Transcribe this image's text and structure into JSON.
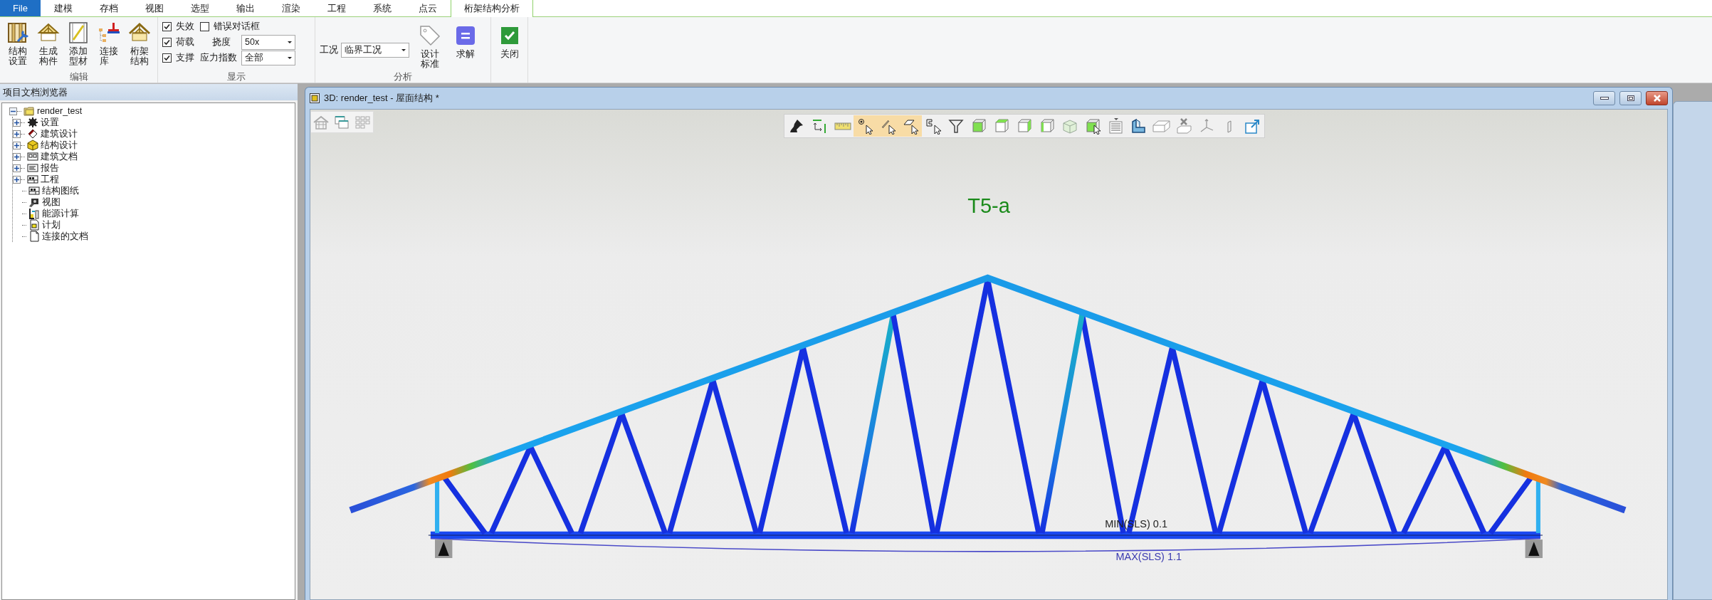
{
  "ribbon": {
    "tabs": [
      {
        "label": "File",
        "kind": "file",
        "selected": false
      },
      {
        "label": "建模",
        "kind": "tab",
        "selected": false
      },
      {
        "label": "存档",
        "kind": "tab",
        "selected": false
      },
      {
        "label": "视图",
        "kind": "tab",
        "selected": false
      },
      {
        "label": "选型",
        "kind": "tab",
        "selected": false
      },
      {
        "label": "输出",
        "kind": "tab",
        "selected": false
      },
      {
        "label": "渲染",
        "kind": "tab",
        "selected": false
      },
      {
        "label": "工程",
        "kind": "tab",
        "selected": false
      },
      {
        "label": "系统",
        "kind": "tab",
        "selected": false
      },
      {
        "label": "点云",
        "kind": "tab",
        "selected": false
      },
      {
        "label": "桁架结构分析",
        "kind": "tab",
        "selected": true
      }
    ],
    "edit_group": {
      "label": "编辑",
      "buttons": [
        {
          "label": "结构设置"
        },
        {
          "label": "生成构件"
        },
        {
          "label": "添加型材"
        },
        {
          "label": "连接库"
        },
        {
          "label": "桁架结构"
        }
      ]
    },
    "display_group": {
      "label": "显示",
      "checkboxes": [
        {
          "label": "失效",
          "checked": true
        },
        {
          "label": "荷载",
          "checked": true
        },
        {
          "label": "支撑",
          "checked": true
        },
        {
          "label": "错误对话框",
          "checked": false
        }
      ],
      "deflection": {
        "label": "挠度",
        "value": "50x"
      },
      "stress_index": {
        "label": "应力指数",
        "value": "全部"
      }
    },
    "analysis_group": {
      "label": "分析",
      "load_case": {
        "label": "工况",
        "value": "临界工况"
      },
      "buttons": [
        {
          "label": "设计标准"
        },
        {
          "label": "求解"
        }
      ]
    },
    "close_group": {
      "buttons": [
        {
          "label": "关闭"
        }
      ]
    }
  },
  "browser": {
    "title": "项目文档浏览器",
    "tree": [
      {
        "label": "render_test",
        "expandable": true,
        "expanded": true,
        "children": [
          {
            "label": "设置",
            "expandable": true,
            "expanded": false
          },
          {
            "label": "建筑设计",
            "expandable": true,
            "expanded": false
          },
          {
            "label": "结构设计",
            "expandable": true,
            "expanded": false
          },
          {
            "label": "建筑文档",
            "expandable": true,
            "expanded": false
          },
          {
            "label": "报告",
            "expandable": true,
            "expanded": false
          },
          {
            "label": "工程",
            "expandable": true,
            "expanded": false
          },
          {
            "label": "结构图纸",
            "expandable": false
          },
          {
            "label": "视图",
            "expandable": false
          },
          {
            "label": "能源计算",
            "expandable": false
          },
          {
            "label": "计划",
            "expandable": false
          },
          {
            "label": "连接的文档",
            "expandable": false
          }
        ]
      }
    ]
  },
  "document_window": {
    "title": "3D: render_test - 屋面结构 *",
    "toolbar": [
      {
        "selected": false
      },
      {
        "selected": false
      },
      {
        "selected": false
      },
      {
        "selected": true
      },
      {
        "selected": true
      },
      {
        "selected": true
      },
      {
        "selected": false
      },
      {
        "selected": false
      },
      {
        "selected": false
      },
      {
        "selected": false
      },
      {
        "selected": false
      },
      {
        "selected": false
      },
      {
        "selected": false
      },
      {
        "selected": false
      },
      {
        "selected": false
      },
      {
        "selected": false
      },
      {
        "selected": false
      },
      {
        "selected": false
      },
      {
        "selected": false
      },
      {
        "selected": false
      },
      {
        "selected": false
      }
    ],
    "view": {
      "title": "T5-a",
      "min_label": "MIN(SLS) 0.1",
      "max_label": "MAX(SLS) 1.1"
    }
  }
}
